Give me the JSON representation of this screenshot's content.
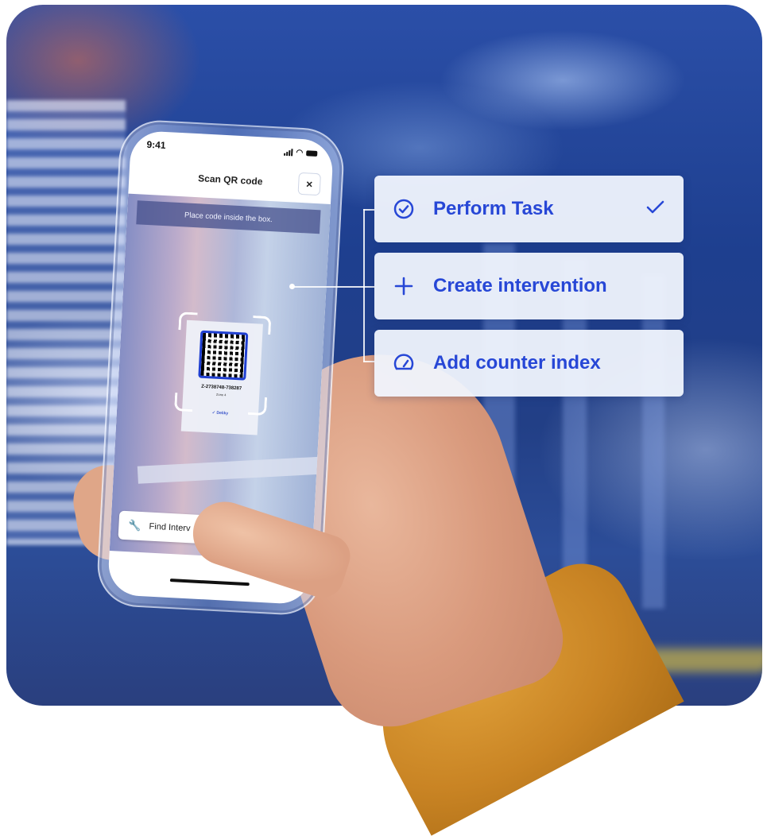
{
  "phone": {
    "time": "9:41",
    "title": "Scan QR code",
    "close_label": "×",
    "instruction": "Place code inside the box.",
    "code_label": {
      "code": "Z-2738748-738287",
      "zone": "Zone 4",
      "brand": "✓ Deliky"
    },
    "find_button_label": "Find Interv"
  },
  "actions": [
    {
      "label": "Perform Task",
      "icon": "check-circle-icon",
      "selected": true
    },
    {
      "label": "Create intervention",
      "icon": "plus-icon",
      "selected": false
    },
    {
      "label": "Add counter index",
      "icon": "gauge-icon",
      "selected": false
    }
  ],
  "colors": {
    "accent": "#2747d6",
    "card_bg": "#f0f4fd",
    "qr_frame": "#1f3fd1",
    "background": "#223f86"
  }
}
